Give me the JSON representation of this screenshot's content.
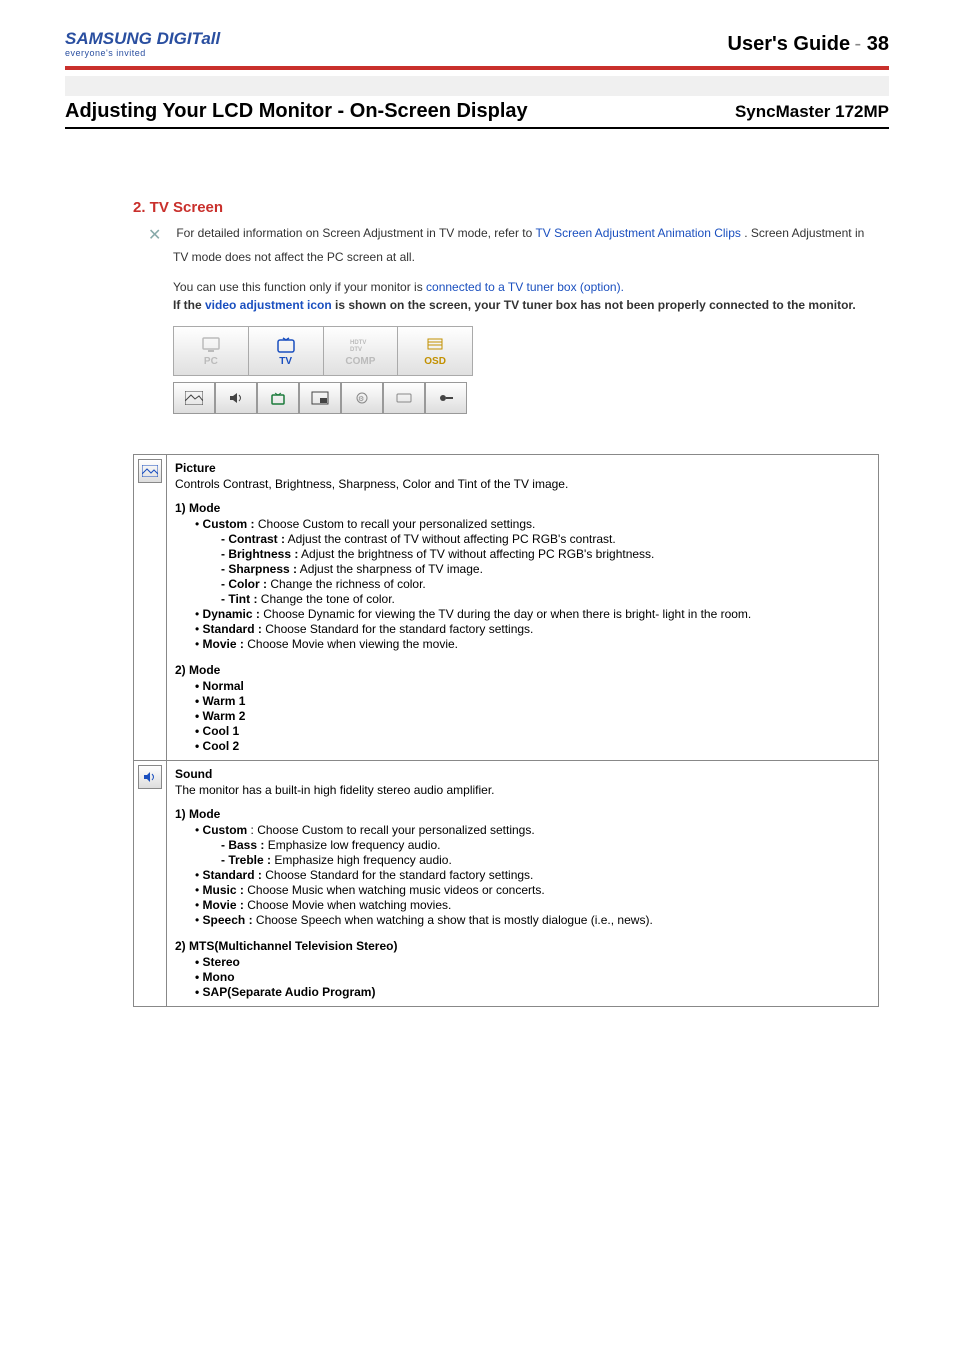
{
  "header": {
    "logo_main": "SAMSUNG DIGITall",
    "logo_sub": "everyone's invited",
    "guide_label": "User's Guide",
    "page_sep": " - ",
    "page_num": "38"
  },
  "title_row": {
    "page_title": "Adjusting Your LCD Monitor - On-Screen Display",
    "model": "SyncMaster 172MP"
  },
  "section": {
    "heading": "2. TV Screen",
    "intro1_pre": "For detailed information on Screen Adjustment in TV mode, refer to ",
    "intro1_link": "TV Screen Adjustment Animation Clips",
    "intro1_post": ". Screen Adjustment in TV mode does not affect the PC screen at all.",
    "intro2_pre": "You can use this function only if your monitor is ",
    "intro2_link": "connected to a TV tuner box (option).",
    "intro3_pre": "If the ",
    "intro3_link": "video adjustment icon",
    "intro3_post": " is shown on the screen, your TV tuner box has not been properly connected to the monitor."
  },
  "tabs": [
    {
      "label": "PC",
      "state": "dim"
    },
    {
      "label": "TV",
      "state": "active"
    },
    {
      "label": "COMP",
      "state": "dim"
    },
    {
      "label": "OSD",
      "state": "osd"
    }
  ],
  "small_icons": [
    "picture",
    "sound",
    "channel",
    "pip",
    "func",
    "size",
    "setup"
  ],
  "picture": {
    "title": "Picture",
    "desc": "Controls Contrast, Brightness, Sharpness, Color and Tint of the TV image.",
    "mode1_heading": "1) Mode",
    "items1": [
      {
        "label": "Custom :",
        "text": " Choose Custom to recall your personalized settings."
      },
      {
        "label": "Dynamic :",
        "text": " Choose Dynamic for viewing the TV during the day or when there is bright- light in the room."
      },
      {
        "label": "Standard :",
        "text": " Choose Standard for the standard factory settings."
      },
      {
        "label": "Movie :",
        "text": " Choose Movie when viewing the movie."
      }
    ],
    "custom_sub": [
      {
        "label": "- Contrast :",
        "text": " Adjust the contrast of TV without affecting PC RGB's contrast."
      },
      {
        "label": "- Brightness :",
        "text": " Adjust the brightness of TV without affecting PC RGB's brightness."
      },
      {
        "label": "- Sharpness :",
        "text": " Adjust the sharpness of TV image."
      },
      {
        "label": "- Color :",
        "text": " Change the richness of color."
      },
      {
        "label": "- Tint :",
        "text": " Change the tone of color."
      }
    ],
    "mode2_heading": "2) Mode",
    "items2": [
      "• Normal",
      "• Warm 1",
      "• Warm 2",
      "• Cool 1",
      "• Cool 2"
    ]
  },
  "sound": {
    "title": "Sound",
    "desc": "The monitor has a built-in high fidelity stereo audio amplifier.",
    "mode1_heading": "1) Mode",
    "items1": [
      {
        "label": "Custom",
        "text": " : Choose Custom to recall your personalized settings."
      },
      {
        "label": "Standard :",
        "text": " Choose Standard for the standard factory settings."
      },
      {
        "label": "Music :",
        "text": " Choose Music when watching music videos or concerts."
      },
      {
        "label": "Movie :",
        "text": " Choose Movie when watching movies."
      },
      {
        "label": "Speech :",
        "text": " Choose Speech when watching a show that is mostly dialogue (i.e., news)."
      }
    ],
    "custom_sub": [
      {
        "label": "- Bass :",
        "text": " Emphasize low frequency audio."
      },
      {
        "label": "- Treble :",
        "text": " Emphasize high frequency audio."
      }
    ],
    "mts_heading": "2) MTS(Multichannel Television Stereo)",
    "mts_items": [
      "• Stereo",
      "• Mono",
      "• SAP(Separate Audio Program)"
    ]
  }
}
